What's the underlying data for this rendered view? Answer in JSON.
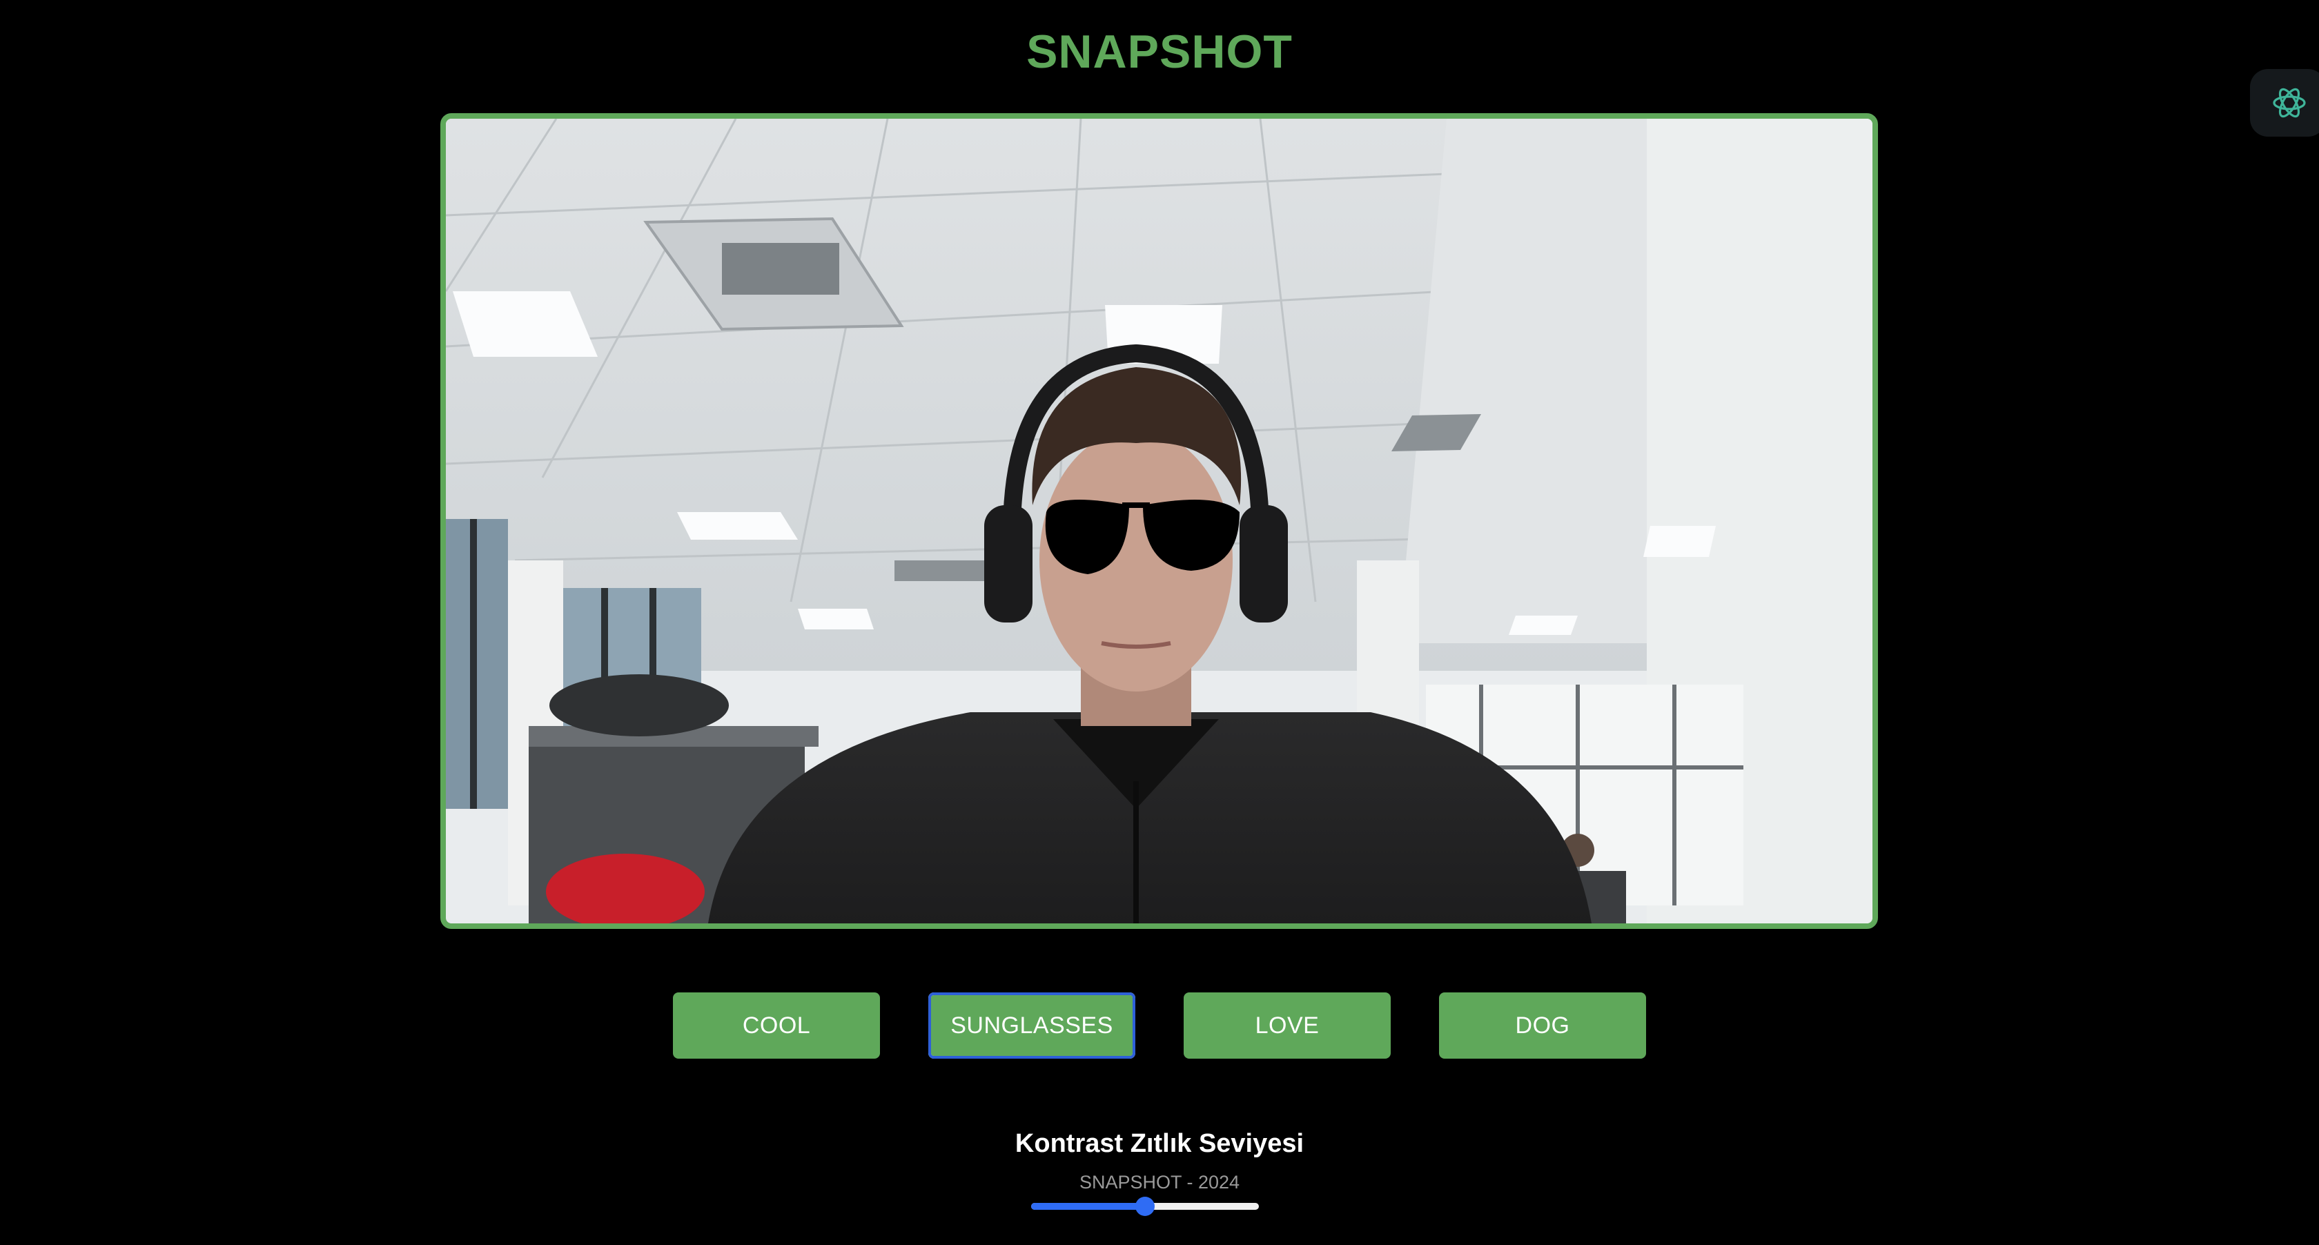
{
  "app": {
    "title": "SNAPSHOT",
    "accent_color": "#5fa85a"
  },
  "camera": {
    "overlay_filter": "sunglasses"
  },
  "extension": {
    "icon": "ai-assistant-icon"
  },
  "filters": {
    "buttons": [
      {
        "label": "COOL",
        "active": false
      },
      {
        "label": "SUNGLASSES",
        "active": true
      },
      {
        "label": "LOVE",
        "active": false
      },
      {
        "label": "DOG",
        "active": false
      }
    ]
  },
  "contrast": {
    "label": "Kontrast Zıtlık Seviyesi",
    "level": 0.5,
    "slider_color": "#2f6cf4"
  },
  "footer": {
    "text": "SNAPSHOT - 2024"
  }
}
